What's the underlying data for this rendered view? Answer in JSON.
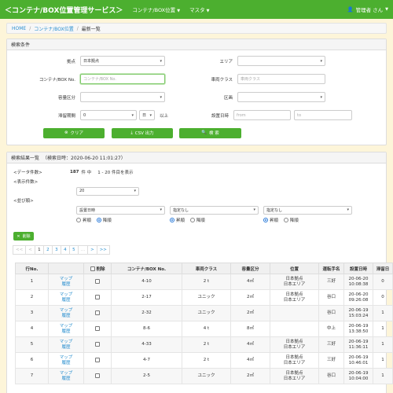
{
  "navbar": {
    "brand": "＜コンテナ/BOX位置管理サービス＞",
    "menu1": "コンテナ/BOX位置",
    "menu2": "マスタ",
    "user": "管理者 さん"
  },
  "breadcrumb": {
    "home": "HOME",
    "section": "コンテナ/BOX位置",
    "current": "最新一覧"
  },
  "search": {
    "title": "検索条件",
    "base_label": "拠点",
    "base_value": "日本拠点",
    "area_label": "エリア",
    "area_value": "",
    "container_label": "コンテナ/BOX No.",
    "container_placeholder": "コンテナ/BOX No.",
    "vehicle_label": "車両クラス",
    "vehicle_placeholder": "車両クラス",
    "capacity_label": "容量区分",
    "capacity_value": "",
    "section_label": "区画",
    "section_value": "",
    "stay_label": "滞留期間",
    "stay_value": "0",
    "stay_unit": "日",
    "stay_suffix": "以上",
    "datetime_label": "設置日時",
    "from_placeholder": "from",
    "to_placeholder": "to",
    "clear_label": "クリア",
    "csv_label": "CSV 出力",
    "search_label": "検 索"
  },
  "results": {
    "title": "検索結果一覧",
    "search_time": "（検索日時：2020-06-20 11:01:27）",
    "count_label": "<データ件数>",
    "count_total": "187",
    "count_text": "件 中",
    "count_range": "1 - 20 件目を表示",
    "display_label": "<表示件数>",
    "display_value": "20",
    "sort_label": "<並び順>",
    "sort1": "設置日時",
    "sort2": "指定なし",
    "sort3": "指定なし",
    "asc": "昇順",
    "desc": "降順",
    "delete_label": "削除",
    "pager": [
      "<<",
      "<",
      "1",
      "2",
      "3",
      "4",
      "5",
      "...",
      ">",
      ">>"
    ]
  },
  "table": {
    "headers": [
      "行No.",
      "",
      "削除",
      "コンテナ/BOX No.",
      "車両クラス",
      "容量区分",
      "位置",
      "運転手名",
      "設置日時",
      "滞留日"
    ],
    "rows": [
      {
        "no": "1",
        "map": "マップ",
        "hist": "履歴",
        "box": "4-10",
        "vehicle": "2 t",
        "capacity": "4㎥",
        "loc1": "日本拠点",
        "loc2": "日本エリア",
        "driver": "三好",
        "date": "20-06-20",
        "time": "10:08:38",
        "stay": "0"
      },
      {
        "no": "2",
        "map": "マップ",
        "hist": "履歴",
        "box": "2-17",
        "vehicle": "ユニック",
        "capacity": "2㎥",
        "loc1": "日本拠点",
        "loc2": "日本エリア",
        "driver": "谷口",
        "date": "20-06-20",
        "time": "09:26:08",
        "stay": "0"
      },
      {
        "no": "3",
        "map": "マップ",
        "hist": "履歴",
        "box": "2-32",
        "vehicle": "ユニック",
        "capacity": "2㎥",
        "loc1": "",
        "loc2": "",
        "driver": "谷口",
        "date": "20-06-19",
        "time": "15:03:24",
        "stay": "1"
      },
      {
        "no": "4",
        "map": "マップ",
        "hist": "履歴",
        "box": "8-6",
        "vehicle": "4 t",
        "capacity": "8㎥",
        "loc1": "",
        "loc2": "",
        "driver": "中上",
        "date": "20-06-19",
        "time": "13:38:50",
        "stay": "1"
      },
      {
        "no": "5",
        "map": "マップ",
        "hist": "履歴",
        "box": "4-33",
        "vehicle": "2 t",
        "capacity": "4㎥",
        "loc1": "日本拠点",
        "loc2": "日本エリア",
        "driver": "三好",
        "date": "20-06-19",
        "time": "11:36:11",
        "stay": "1"
      },
      {
        "no": "6",
        "map": "マップ",
        "hist": "履歴",
        "box": "4-7",
        "vehicle": "2 t",
        "capacity": "4㎥",
        "loc1": "日本拠点",
        "loc2": "日本エリア",
        "driver": "三好",
        "date": "20-06-19",
        "time": "10:46:01",
        "stay": "1"
      },
      {
        "no": "7",
        "map": "マップ",
        "hist": "履歴",
        "box": "2-5",
        "vehicle": "ユニック",
        "capacity": "2㎥",
        "loc1": "日本拠点",
        "loc2": "日本エリア",
        "driver": "谷口",
        "date": "20-06-19",
        "time": "10:04:00",
        "stay": "1"
      }
    ]
  },
  "colors": {
    "navbar": "#4caf2f",
    "link": "#2a8fcf",
    "background": "#fdf5d9"
  }
}
